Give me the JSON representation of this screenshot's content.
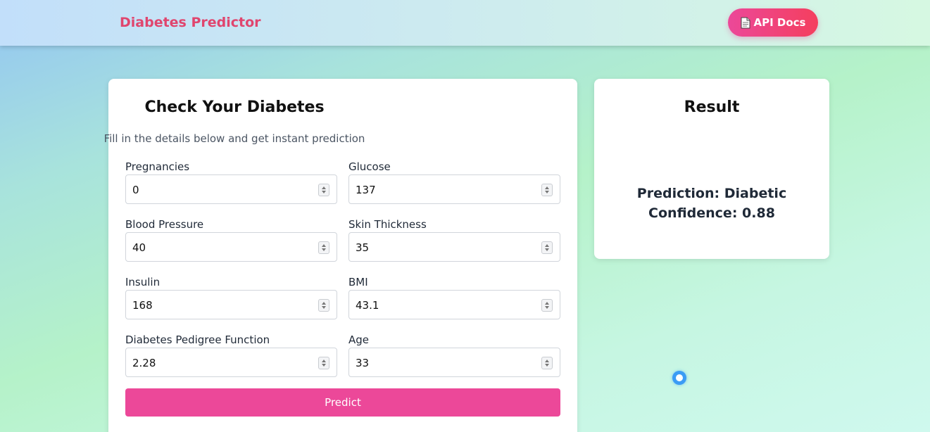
{
  "navbar": {
    "brand": "Diabetes Predictor",
    "api_docs_label": "API Docs",
    "api_docs_icon": "document-icon"
  },
  "form": {
    "title": "Check Your Diabetes",
    "subtitle": "Fill in the details below and get instant prediction",
    "fields": [
      {
        "label": "Pregnancies",
        "value": "0"
      },
      {
        "label": "Glucose",
        "value": "137"
      },
      {
        "label": "Blood Pressure",
        "value": "40"
      },
      {
        "label": "Skin Thickness",
        "value": "35"
      },
      {
        "label": "Insulin",
        "value": "168"
      },
      {
        "label": "BMI",
        "value": "43.1"
      },
      {
        "label": "Diabetes Pedigree Function",
        "value": "2.28"
      },
      {
        "label": "Age",
        "value": "33"
      }
    ],
    "submit_label": "Predict"
  },
  "result": {
    "title": "Result",
    "prediction_key": "Prediction:",
    "prediction_value": "Diabetic",
    "confidence_key": "Confidence:",
    "confidence_value": "0.88"
  },
  "colors": {
    "accent": "#ec4899",
    "brand": "#e0456e",
    "loader": "#3b9cf5"
  }
}
